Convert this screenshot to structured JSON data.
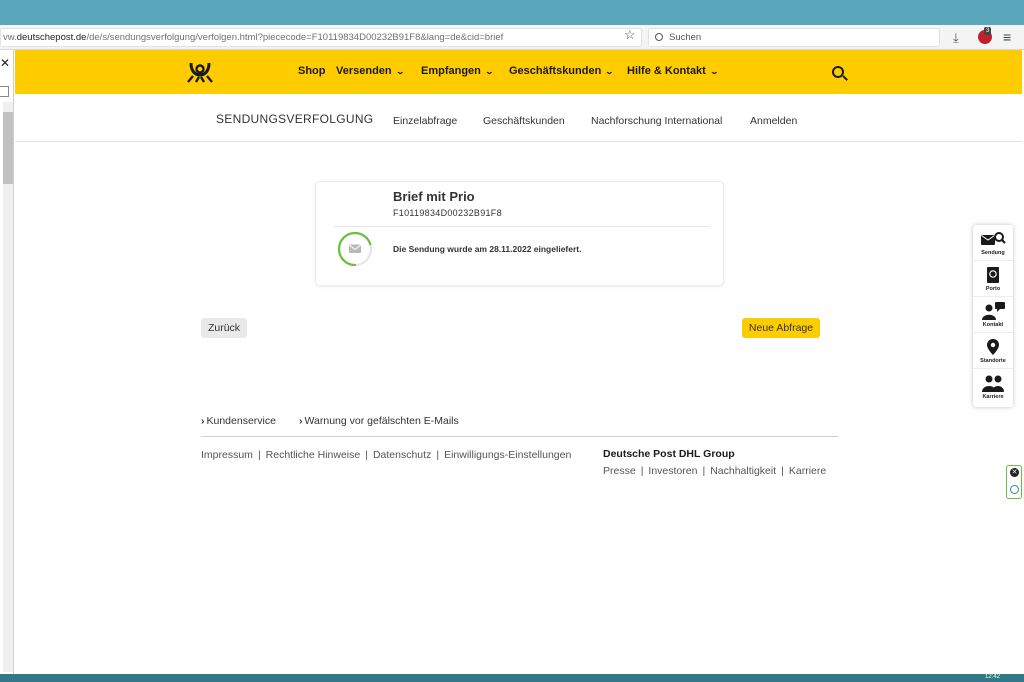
{
  "browser": {
    "url_prefix": "vw.",
    "url_domain": "deutschepost.de",
    "url_path": "/de/s/sendungsverfolgung/verfolgen.html?piececode=F10119834D00232B91F8&lang=de&cid=brief",
    "search_placeholder": "Suchen",
    "extension_badge": "3"
  },
  "nav": {
    "items": [
      {
        "label": "Shop",
        "has_chevron": false
      },
      {
        "label": "Versenden",
        "has_chevron": true
      },
      {
        "label": "Empfangen",
        "has_chevron": true
      },
      {
        "label": "Geschäftskunden",
        "has_chevron": true
      },
      {
        "label": "Hilfe & Kontakt",
        "has_chevron": true
      }
    ]
  },
  "subnav": {
    "title": "SENDUNGSVERFOLGUNG",
    "links": [
      "Einzelabfrage",
      "Geschäftskunden",
      "Nachforschung International",
      "Anmelden"
    ]
  },
  "shipment": {
    "title": "Brief mit Prio",
    "code": "F10119834D00232B91F8",
    "status": "Die Sendung wurde am 28.11.2022 eingeliefert.",
    "progress_fraction": 0.7
  },
  "buttons": {
    "back": "Zurück",
    "new_query": "Neue Abfrage"
  },
  "footer": {
    "links": [
      "Kundenservice",
      "Warnung vor gefälschten E-Mails"
    ],
    "legal": [
      "Impressum",
      "Rechtliche Hinweise",
      "Datenschutz",
      "Einwilligungs-Einstellungen"
    ],
    "brand": "Deutsche Post DHL Group",
    "brand_links": [
      "Presse",
      "Investoren",
      "Nachhaltigkeit",
      "Karriere"
    ]
  },
  "sidebar": {
    "items": [
      {
        "label": "Sendung",
        "icon": "envelope-search-icon"
      },
      {
        "label": "Porto",
        "icon": "stamp-icon"
      },
      {
        "label": "Kontakt",
        "icon": "contact-icon"
      },
      {
        "label": "Standorte",
        "icon": "location-pin-icon"
      },
      {
        "label": "Karriere",
        "icon": "people-icon"
      }
    ]
  },
  "taskbar": {
    "time": "12:42"
  },
  "colors": {
    "brand_yellow": "#ffcc00",
    "progress_green": "#6bbf3d"
  }
}
